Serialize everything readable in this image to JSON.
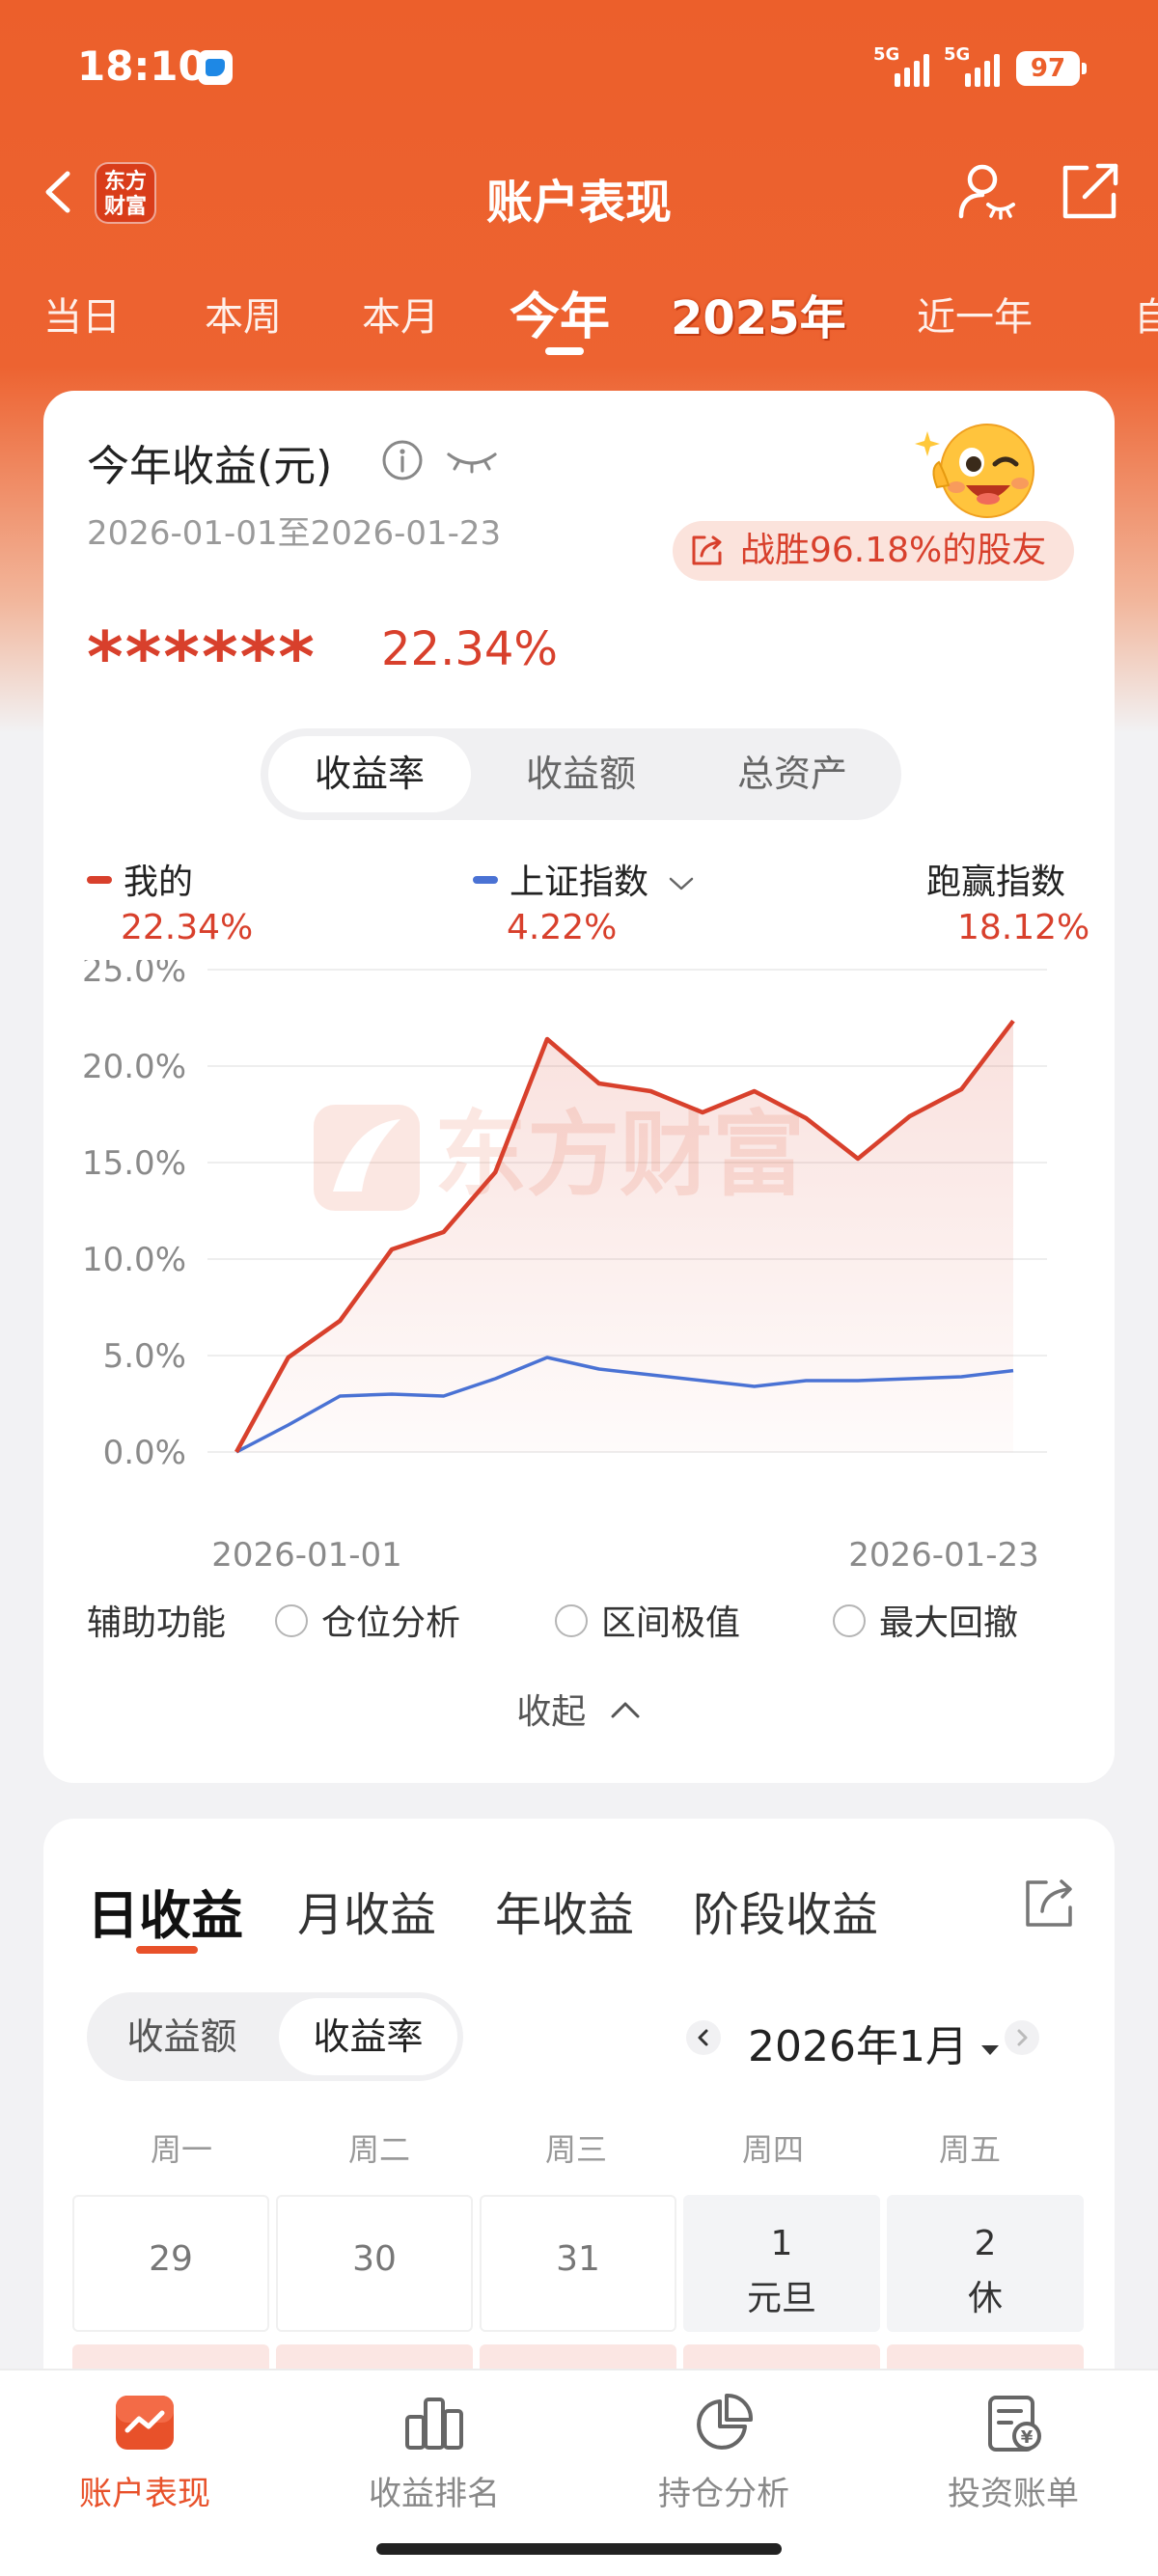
{
  "status_bar": {
    "time": "18:10",
    "network_1": "5G",
    "network_2": "5G",
    "battery": "97"
  },
  "nav": {
    "title": "账户表现",
    "logo_line1": "东方",
    "logo_line2": "财富"
  },
  "period_tabs": [
    {
      "label": "当日"
    },
    {
      "label": "本周"
    },
    {
      "label": "本月"
    },
    {
      "label": "今年",
      "active": true
    },
    {
      "label": "2025年"
    },
    {
      "label": "近一年"
    },
    {
      "label": "自"
    }
  ],
  "summary": {
    "title": "今年收益(元)",
    "date_range": "2026-01-01至2026-01-23",
    "beat_text": "战胜96.18%的股友",
    "masked_amount": "******",
    "return_pct": "22.34%"
  },
  "chart_toggle": {
    "options": [
      "收益率",
      "收益额",
      "总资产"
    ],
    "selected": "收益率"
  },
  "legend": {
    "mine_label": "我的",
    "mine_value": "22.34%",
    "index_label": "上证指数",
    "index_value": "4.22%",
    "outperform_label": "跑赢指数",
    "outperform_value": "18.12%"
  },
  "watermark": "东方财富",
  "chart_data": {
    "type": "line",
    "x": [
      "2026-01-01",
      "",
      "",
      "",
      "",
      "",
      "",
      "",
      "",
      "",
      "",
      "",
      "",
      "",
      "",
      "",
      "2026-01-23"
    ],
    "xtick_labels": [
      "2026-01-01",
      "2026-01-23"
    ],
    "ytick_labels": [
      "0.0%",
      "5.0%",
      "10.0%",
      "15.0%",
      "20.0%",
      "25.0%"
    ],
    "ylim": [
      0,
      25
    ],
    "grid": true,
    "legend_placement": "top",
    "series": [
      {
        "name": "我的",
        "color": "#d8402c",
        "fill": true,
        "values": [
          0.0,
          4.9,
          6.8,
          10.5,
          11.4,
          14.5,
          21.4,
          19.1,
          18.7,
          17.6,
          18.7,
          17.3,
          15.2,
          17.4,
          18.8,
          22.34
        ]
      },
      {
        "name": "上证指数",
        "color": "#4a72d4",
        "fill": false,
        "values": [
          0.0,
          1.4,
          2.9,
          3.0,
          2.9,
          3.8,
          4.9,
          4.3,
          4.0,
          3.7,
          3.4,
          3.7,
          3.7,
          3.8,
          3.9,
          4.22
        ]
      }
    ]
  },
  "aux": {
    "label": "辅助功能",
    "options": [
      "仓位分析",
      "区间极值",
      "最大回撤"
    ],
    "collapse": "收起"
  },
  "returns_tabs": [
    {
      "label": "日收益",
      "active": true
    },
    {
      "label": "月收益"
    },
    {
      "label": "年收益"
    },
    {
      "label": "阶段收益"
    }
  ],
  "calendar": {
    "mode_options": [
      "收益额",
      "收益率"
    ],
    "mode_selected": "收益率",
    "month": "2026年1月",
    "weekdays": [
      "周一",
      "周二",
      "周三",
      "周四",
      "周五"
    ],
    "cells": [
      {
        "day": "29",
        "note": ""
      },
      {
        "day": "30",
        "note": ""
      },
      {
        "day": "31",
        "note": ""
      },
      {
        "day": "1",
        "note": "元旦"
      },
      {
        "day": "2",
        "note": "休"
      }
    ]
  },
  "bottom_nav": [
    {
      "label": "账户表现",
      "active": true
    },
    {
      "label": "收益排名"
    },
    {
      "label": "持仓分析"
    },
    {
      "label": "投资账单"
    }
  ],
  "colors": {
    "brand": "#ec5f2b",
    "accent_red": "#d8402c",
    "index_blue": "#4a72d4"
  }
}
